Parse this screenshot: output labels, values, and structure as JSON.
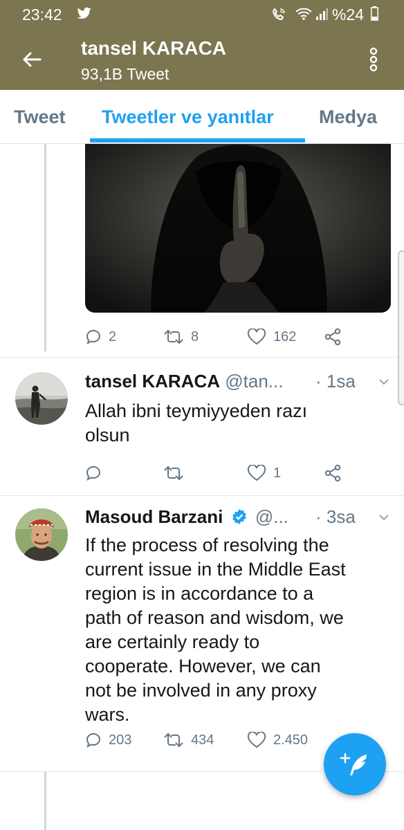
{
  "status_bar": {
    "time": "23:42",
    "battery": "%24",
    "left_icon": "twitter-bird-icon",
    "right_icons": [
      "wifi-call-icon",
      "wifi-icon",
      "signal-icon",
      "battery-icon"
    ]
  },
  "header": {
    "title": "tansel KARACA",
    "subtitle": "93,1B Tweet"
  },
  "tabs": [
    {
      "label": "Tweet",
      "active": false
    },
    {
      "label": "Tweetler ve yanıtlar",
      "active": true
    },
    {
      "label": "Medya",
      "active": false
    }
  ],
  "tweets": [
    {
      "media": "hooded-figure-photo",
      "replies": "2",
      "retweets": "8",
      "likes": "162"
    },
    {
      "name": "tansel KARACA",
      "handle": "@tan...",
      "time": "· 1sa",
      "text": "Allah ibni teymiyyeden razı\nolsun",
      "replies": "",
      "retweets": "",
      "likes": "1"
    },
    {
      "name": "Masoud Barzani",
      "verified": true,
      "handle": "@...",
      "time": "· 3sa",
      "text": "If the process of resolving the\ncurrent issue in the Middle East\nregion is in accordance to a\npath of reason and wisdom, we\nare certainly ready to\ncooperate. However, we can\nnot be involved in any proxy\nwars.",
      "replies": "203",
      "retweets": "434",
      "likes": "2.450"
    }
  ],
  "colors": {
    "header_bg": "#7b7650",
    "accent": "#1da1f2",
    "muted": "#657786"
  }
}
